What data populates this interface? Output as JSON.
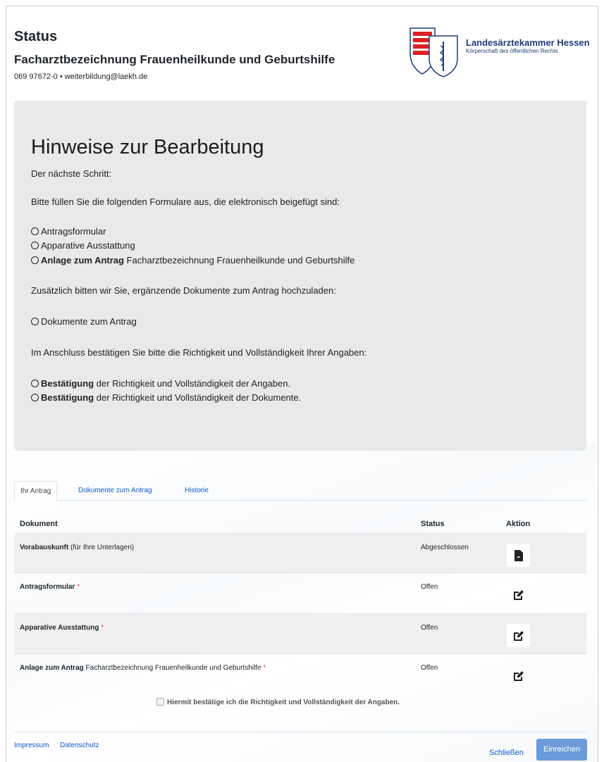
{
  "header": {
    "title": "Status",
    "subtitle": "Facharztbezeichnung Frauenheilkunde und Geburtshilfe",
    "contact": "069 97672-0 • weiterbildung@laekh.de",
    "logo_name": "Landesärztekammer Hessen",
    "logo_tagline": "Körperschaft des öffentlichen Rechts"
  },
  "info": {
    "heading": "Hinweise zur Bearbeitung",
    "next_step": "Der nächste Schritt:",
    "fill_forms": "Bitte füllen Sie die folgenden Formulare aus, die elektronisch beigefügt sind:",
    "forms": [
      {
        "bold": "",
        "text": "Antragsformular"
      },
      {
        "bold": "",
        "text": "Apparative Ausstattung"
      },
      {
        "bold": "Anlage zum Antrag",
        "text": " Facharztbezeichnung Frauenheilkunde und Geburtshilfe"
      }
    ],
    "upload_docs": "Zusätzlich bitten wir Sie, ergänzende Dokumente zum Antrag hochzuladen:",
    "doc_item": "Dokumente zum Antrag",
    "confirm_intro": "Im Anschluss bestätigen Sie bitte die Richtigkeit und Vollständigkeit Ihrer Angaben:",
    "confirm_items": [
      {
        "bold": "Bestätigung",
        "text": " der Richtigkeit und Vollständigkeit der Angaben."
      },
      {
        "bold": "Bestätigung",
        "text": " der Richtigkeit und Vollständigkeit der Dokumente."
      }
    ]
  },
  "tabs": [
    "Ihr Antrag",
    "Dokumente zum Antrag",
    "Historie"
  ],
  "table": {
    "headers": {
      "document": "Dokument",
      "status": "Status",
      "action": "Aktion"
    },
    "rows": [
      {
        "name": "Vorabauskunft",
        "extra": " (für Ihre Unterlagen)",
        "required": "",
        "status": "Abgeschlossen",
        "action_icon": "pdf-icon"
      },
      {
        "name": "Antragsformular",
        "extra": "",
        "required": " *",
        "status": "Offen",
        "action_icon": "edit-icon"
      },
      {
        "name": "Apparative Ausstattung",
        "extra": "",
        "required": " *",
        "status": "Offen",
        "action_icon": "edit-icon"
      },
      {
        "name": "Anlage zum Antrag",
        "extra": " Facharztbezeichnung Frauenheilkunde und Geburtshilfe",
        "required": " *",
        "status": "Offen",
        "action_icon": "edit-icon"
      }
    ]
  },
  "confirmation": "Hiermit bestätige ich die Richtigkeit und Vollständigkeit der Angaben.",
  "footer": {
    "impressum": "Impressum",
    "datenschutz": "Datenschutz",
    "close": "Schließen",
    "submit": "Einreichen"
  },
  "colors": {
    "link": "#0a58ca",
    "submit": "#6c9bd9",
    "required": "#d9534f",
    "info_bg": "#e8e9ea"
  }
}
